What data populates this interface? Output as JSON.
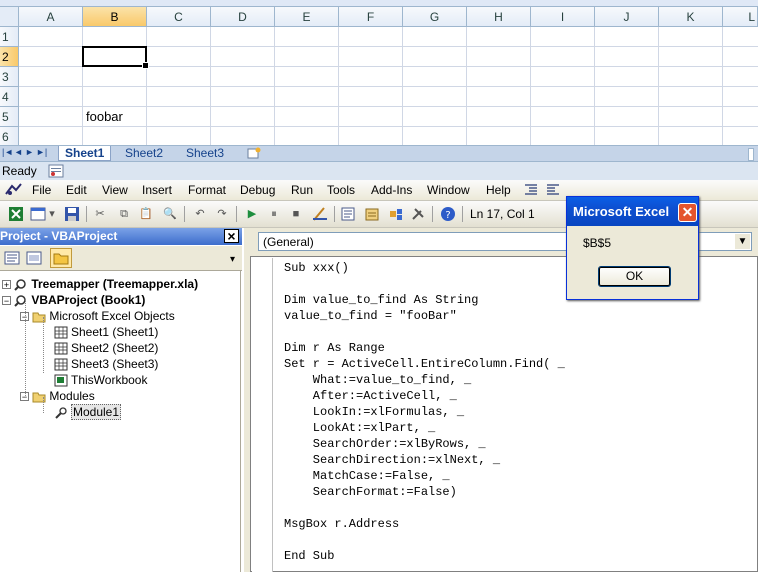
{
  "excel": {
    "columns": [
      "A",
      "B",
      "C",
      "D",
      "E",
      "F",
      "G",
      "H",
      "I",
      "J",
      "K",
      "L"
    ],
    "rows": [
      "1",
      "2",
      "3",
      "4",
      "5",
      "6"
    ],
    "cells": {
      "B5": "foobar"
    },
    "sheet_tabs": [
      "Sheet1",
      "Sheet2",
      "Sheet3"
    ],
    "nav_arrows": [
      "|◄",
      "◄",
      "►",
      "►|"
    ],
    "status": "Ready"
  },
  "vbe": {
    "menus": [
      "File",
      "Edit",
      "View",
      "Insert",
      "Format",
      "Debug",
      "Run",
      "Tools",
      "Add-Ins",
      "Window",
      "Help"
    ],
    "position": "Ln 17, Col 1",
    "project": {
      "title": "Project - VBAProject",
      "close": "×",
      "tree": [
        {
          "label": "Treemapper (Treemapper.xla)",
          "bold": true
        },
        {
          "label": "VBAProject (Book1)",
          "bold": true
        },
        {
          "label": "Microsoft Excel Objects"
        },
        {
          "label": "Sheet1 (Sheet1)"
        },
        {
          "label": "Sheet2 (Sheet2)"
        },
        {
          "label": "Sheet3 (Sheet3)"
        },
        {
          "label": "ThisWorkbook"
        },
        {
          "label": "Modules"
        },
        {
          "label": "Module1"
        }
      ]
    },
    "code": {
      "object_combo": "(General)",
      "lines": [
        "Sub xxx()",
        "",
        "Dim value_to_find As String",
        "value_to_find = \"fooBar\"",
        "",
        "Dim r As Range",
        "Set r = ActiveCell.EntireColumn.Find( _",
        "    What:=value_to_find, _",
        "    After:=ActiveCell, _",
        "    LookIn:=xlFormulas, _",
        "    LookAt:=xlPart, _",
        "    SearchOrder:=xlByRows, _",
        "    SearchDirection:=xlNext, _",
        "    MatchCase:=False, _",
        "    SearchFormat:=False)",
        "",
        "MsgBox r.Address",
        "",
        "End Sub"
      ]
    }
  },
  "dialog": {
    "title": "Microsoft Excel",
    "message": "$B$5",
    "ok": "OK"
  }
}
